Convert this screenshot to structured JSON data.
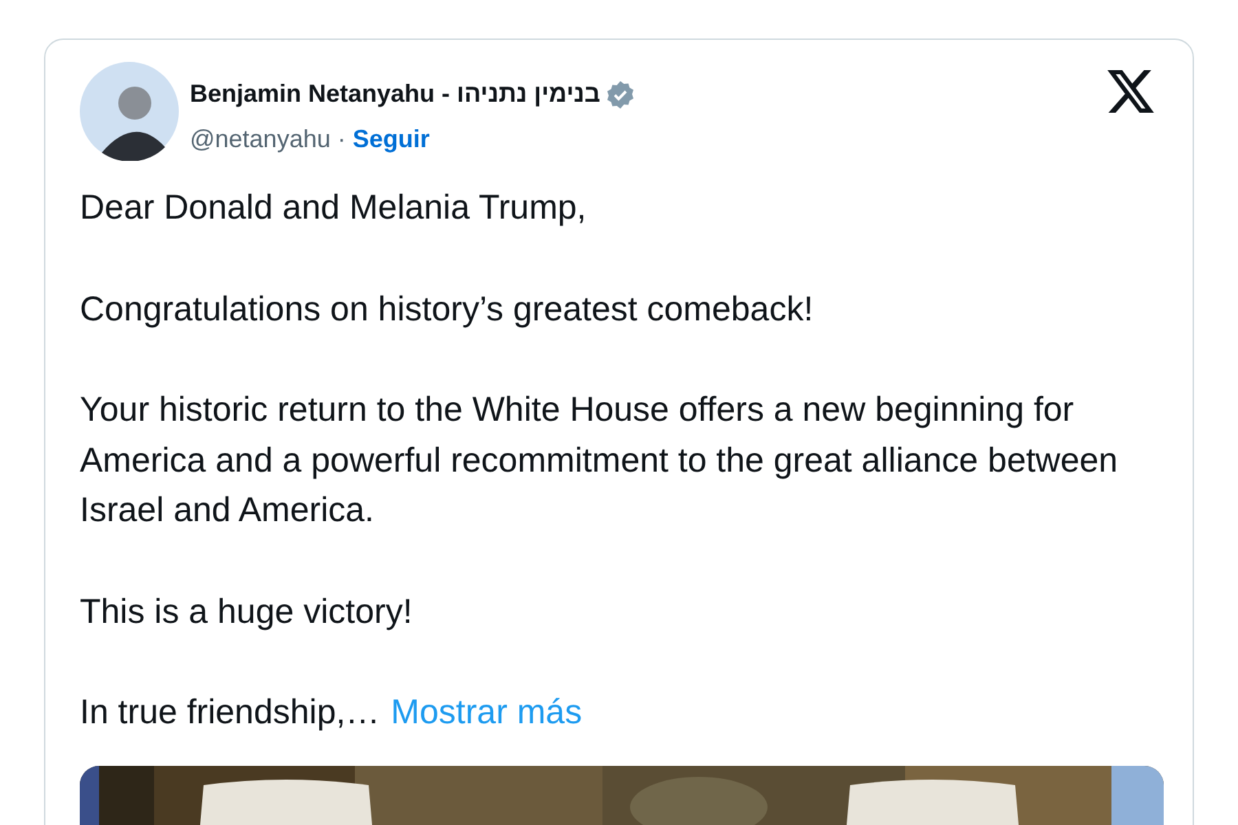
{
  "author": {
    "name": "Benjamin Netanyahu - בנימין נתניהו",
    "verified": true,
    "handle": "@netanyahu",
    "separator": "·",
    "follow": "Seguir"
  },
  "paragraphs": [
    "Dear Donald and Melania Trump,",
    "Congratulations on history’s greatest comeback!",
    "Your historic return to the White House offers a new beginning for America and a powerful recommitment to the great alliance between Israel and America.",
    "This is a huge victory!",
    "In true friendship,…"
  ],
  "show_more": "Mostrar más"
}
